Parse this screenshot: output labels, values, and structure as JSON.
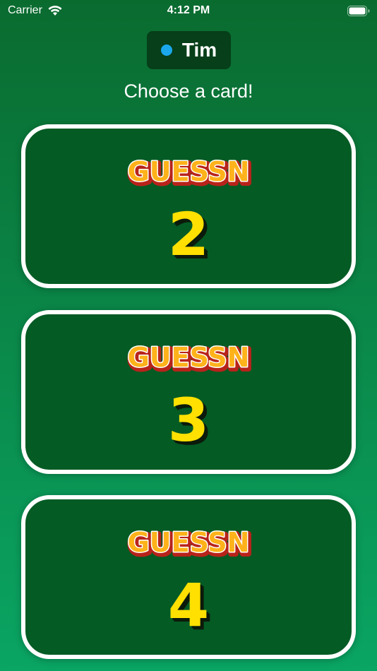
{
  "status_bar": {
    "carrier": "Carrier",
    "time": "4:12 PM",
    "wifi_icon": "wifi-icon",
    "battery_icon": "battery-icon"
  },
  "player": {
    "name": "Tim",
    "indicator_color": "#1aa7ec"
  },
  "prompt": "Choose a card!",
  "cards": [
    {
      "logo": "GUESSN",
      "number": "2"
    },
    {
      "logo": "GUESSN",
      "number": "3"
    },
    {
      "logo": "GUESSN",
      "number": "4"
    }
  ],
  "colors": {
    "background_top": "#0a6b2f",
    "background_bottom": "#0aa563",
    "card_fill": "#045b24",
    "card_border": "#ffffff",
    "number_color": "#ffe000",
    "logo_fill": "#ffb21a",
    "logo_outline": "#b8231a"
  }
}
